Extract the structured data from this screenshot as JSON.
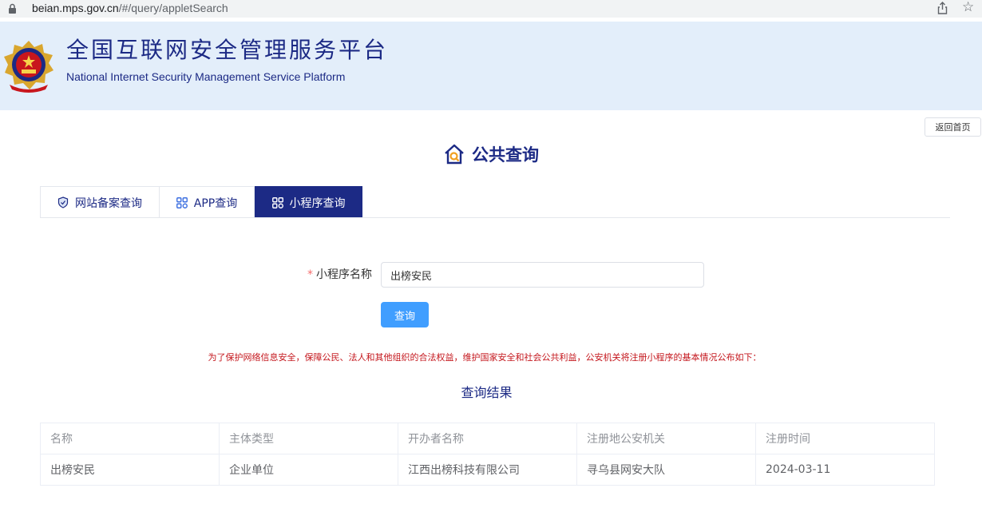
{
  "browser": {
    "url_host": "beian.mps.gov.cn",
    "url_path": "/#/query/appletSearch"
  },
  "header": {
    "title_cn": "全国互联网安全管理服务平台",
    "title_en": "National Internet Security Management Service Platform"
  },
  "home_button": "返回首页",
  "page_title": "公共查询",
  "tabs": [
    {
      "label": "网站备案查询",
      "icon": "shield-icon",
      "active": false
    },
    {
      "label": "APP查询",
      "icon": "app-grid-icon",
      "active": false
    },
    {
      "label": "小程序查询",
      "icon": "miniprogram-icon",
      "active": true
    }
  ],
  "form": {
    "required_mark": "*",
    "label": "小程序名称",
    "value": "出榜安民",
    "button": "查询"
  },
  "notice": "为了保护网络信息安全，保障公民、法人和其他组织的合法权益，维护国家安全和社会公共利益，公安机关将注册小程序的基本情况公布如下：",
  "results": {
    "title": "查询结果",
    "columns": [
      "名称",
      "主体类型",
      "开办者名称",
      "注册地公安机关",
      "注册时间"
    ],
    "rows": [
      [
        "出榜安民",
        "企业单位",
        "江西出榜科技有限公司",
        "寻乌县网安大队",
        "2024-03-11"
      ]
    ]
  },
  "colors": {
    "brand_navy": "#1c2a85",
    "banner_bg": "#e3eefa",
    "primary_button": "#409eff",
    "notice_red": "#c4161c"
  }
}
